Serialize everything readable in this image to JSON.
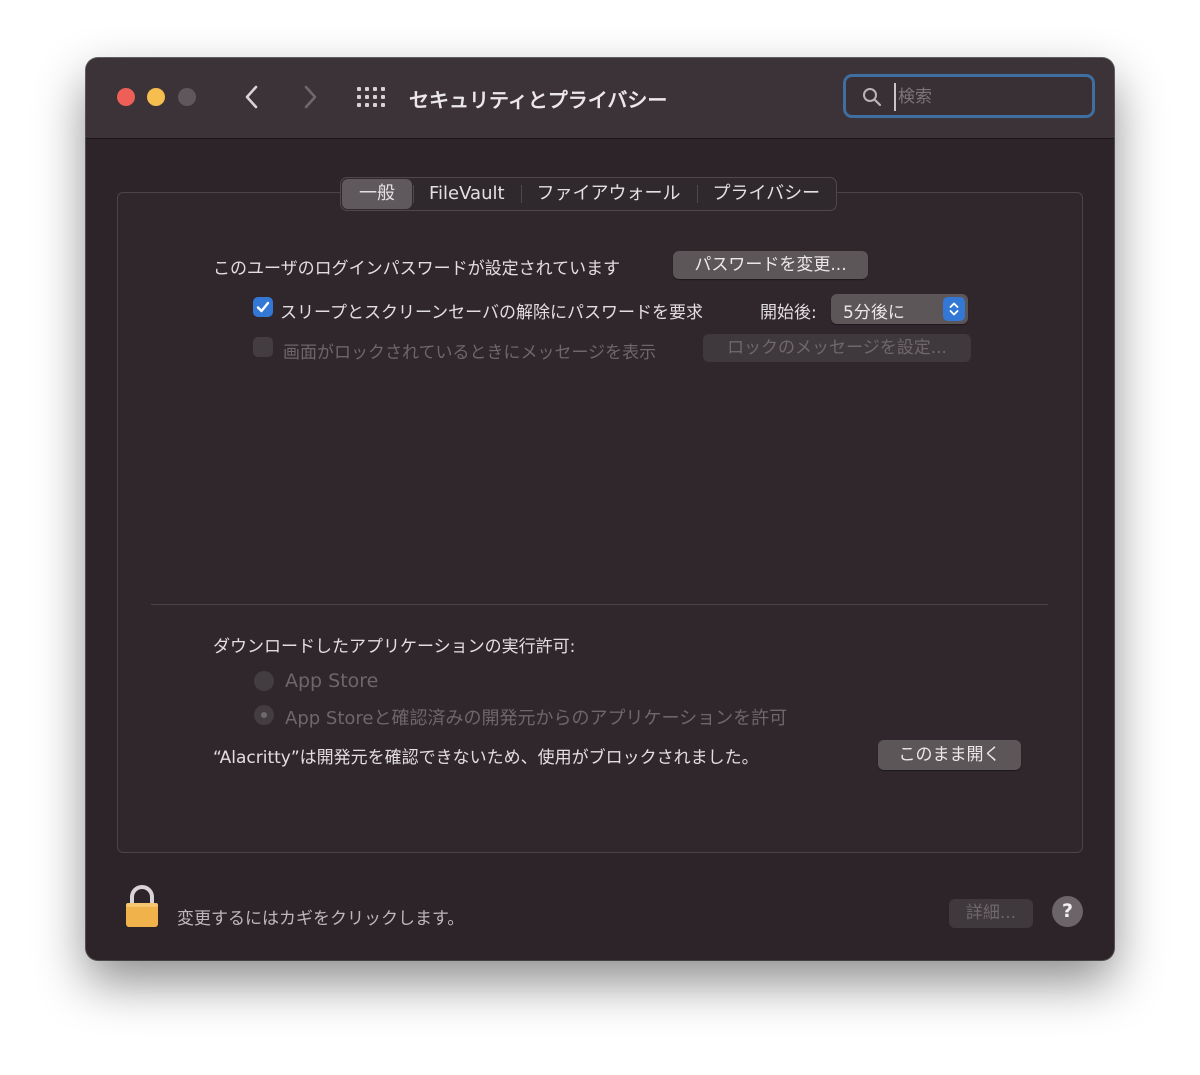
{
  "window": {
    "title": "セキュリティとプライバシー",
    "search_placeholder": "検索"
  },
  "tabs": [
    {
      "label": "一般",
      "active": true
    },
    {
      "label": "FileVault",
      "active": false
    },
    {
      "label": "ファイアウォール",
      "active": false
    },
    {
      "label": "プライバシー",
      "active": false
    }
  ],
  "general": {
    "password_status": "このユーザのログインパスワードが設定されています",
    "change_password_button": "パスワードを変更...",
    "require_password_label": "スリープとスクリーンセーバの解除にパスワードを要求",
    "require_password_checked": true,
    "start_after_label": "開始後:",
    "start_after_value": "5分後に",
    "lock_message_label": "画面がロックされているときにメッセージを表示",
    "lock_message_checked": false,
    "set_lock_message_button": "ロックのメッセージを設定..."
  },
  "downloads": {
    "heading": "ダウンロードしたアプリケーションの実行許可:",
    "options": [
      {
        "label": "App Store",
        "selected": false
      },
      {
        "label": "App Storeと確認済みの開発元からのアプリケーションを許可",
        "selected": true
      }
    ],
    "blocked_message": "“Alacritty”は開発元を確認できないため、使用がブロックされました。",
    "open_anyway_button": "このまま開く"
  },
  "footer": {
    "lock_text": "変更するにはカギをクリックします。",
    "advanced_button": "詳細...",
    "help_label": "?"
  },
  "colors": {
    "accent": "#3478d6",
    "window_bg": "#2c2429",
    "titlebar_bg": "#3b3337",
    "lock": "#f0b24a"
  }
}
